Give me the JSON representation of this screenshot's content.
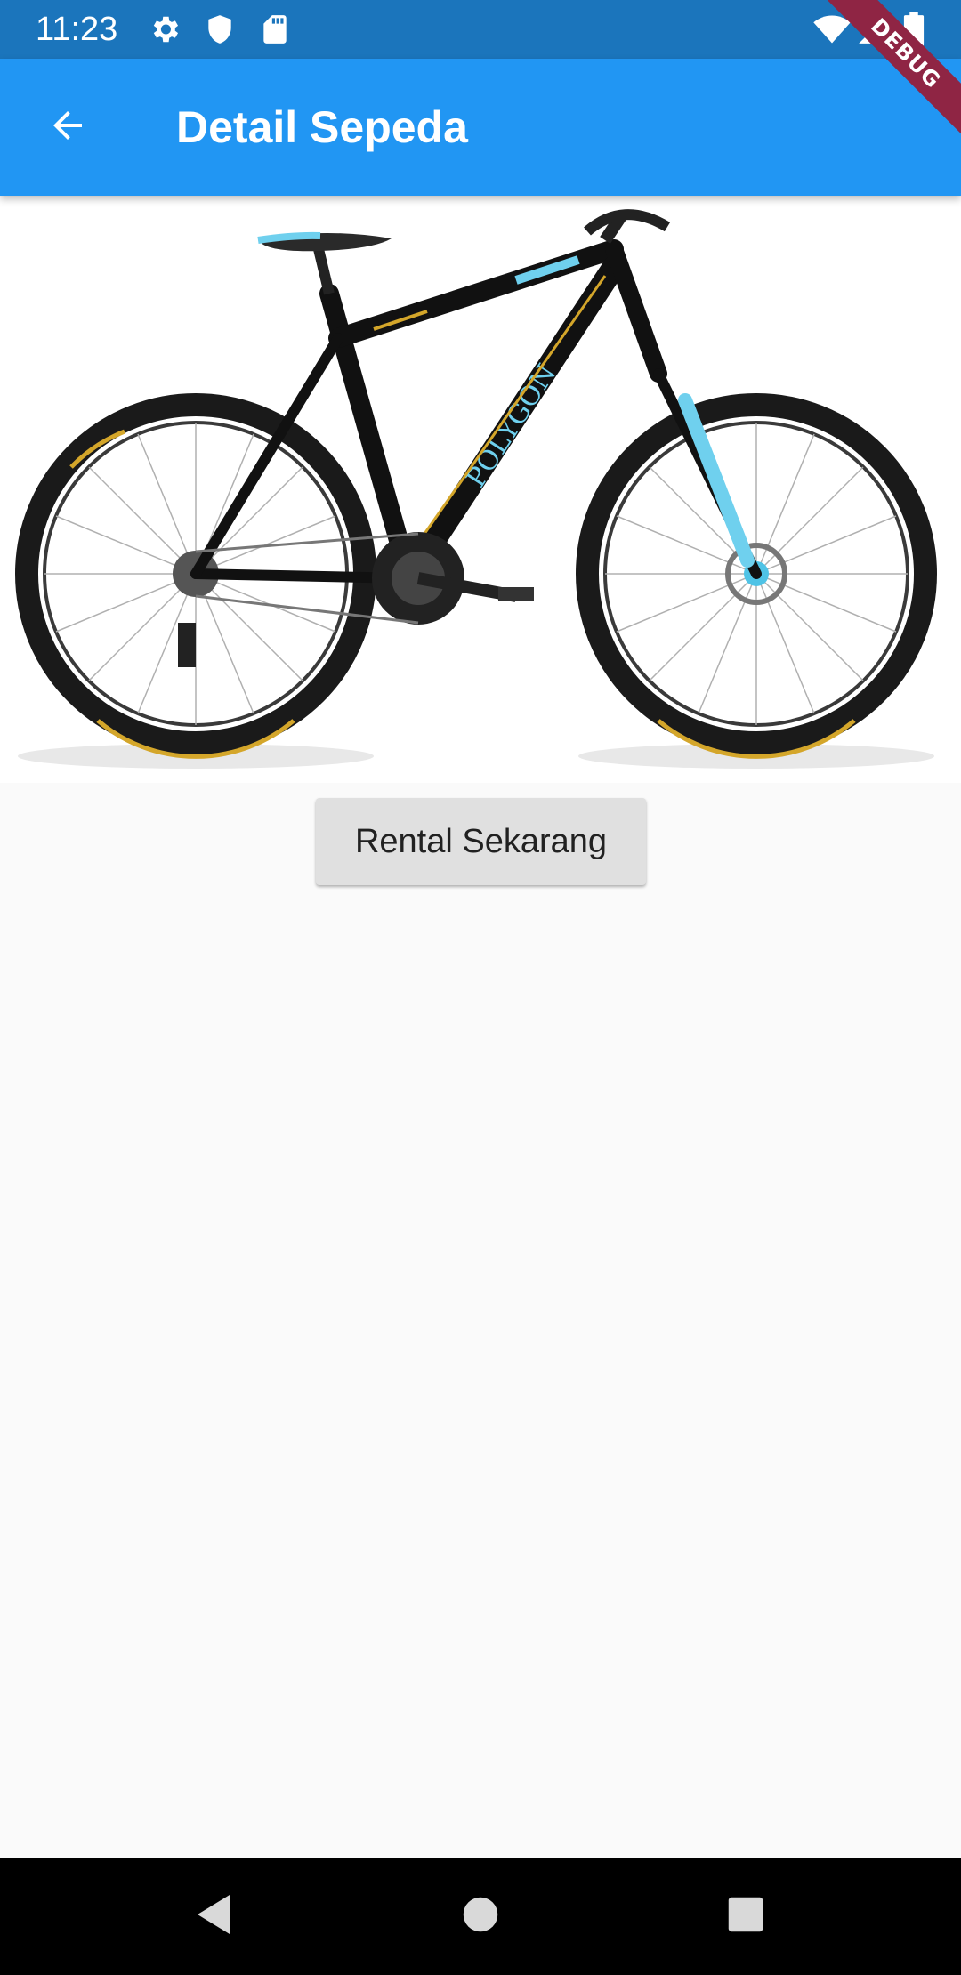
{
  "status_bar": {
    "time": "11:23",
    "icons": [
      "gear-icon",
      "shield-icon",
      "sd-card-icon",
      "wifi-icon",
      "signal-icon",
      "battery-icon"
    ],
    "background": "#1b75bc"
  },
  "app_bar": {
    "title": "Detail Sepeda",
    "back_icon": "arrow-back-icon",
    "background": "#2196f3"
  },
  "debug_banner": {
    "label": "DEBUG",
    "color": "#8f2544"
  },
  "main": {
    "image_brand_text": "POLYGON",
    "rent_button_label": "Rental Sekarang"
  },
  "nav_bar": {
    "icons": [
      "back-triangle-icon",
      "home-circle-icon",
      "recents-square-icon"
    ]
  }
}
